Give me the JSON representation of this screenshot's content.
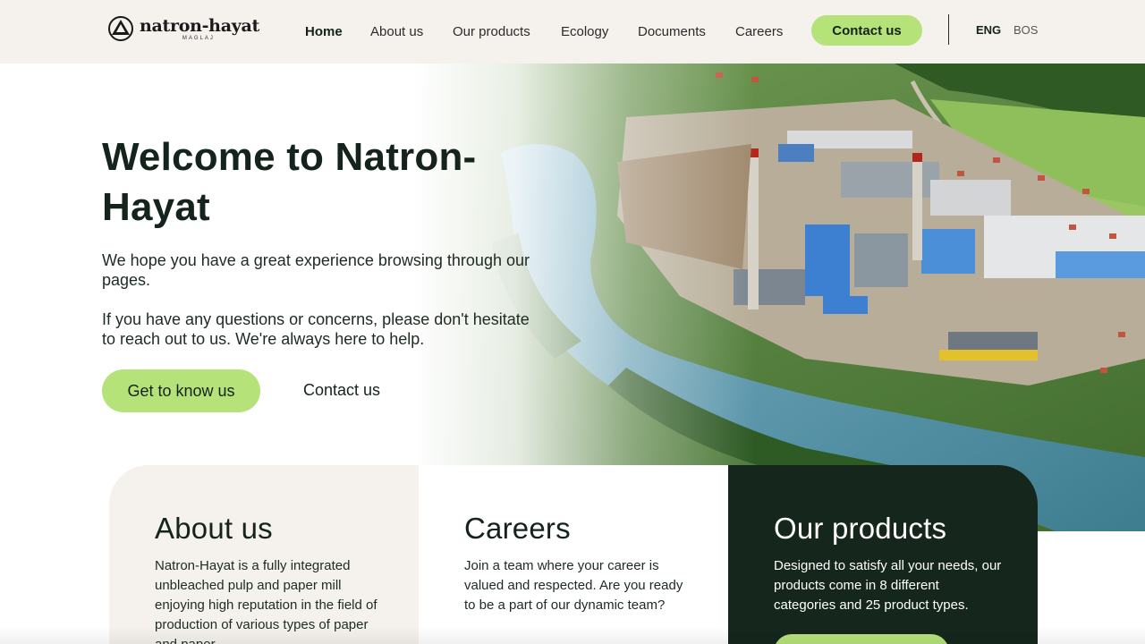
{
  "header": {
    "logo": {
      "name": "natron-hayat",
      "sub": "MAGLAJ"
    },
    "nav": [
      {
        "label": "Home",
        "active": true
      },
      {
        "label": "About us"
      },
      {
        "label": "Our products"
      },
      {
        "label": "Ecology"
      },
      {
        "label": "Documents"
      },
      {
        "label": "Careers"
      }
    ],
    "contact_button": "Contact us",
    "languages": [
      "ENG",
      "BOS"
    ],
    "active_language": "ENG"
  },
  "hero": {
    "title": "Welcome to Natron-Hayat",
    "paragraph1": "We hope you have a great experience browsing through our pages.",
    "paragraph2": "If you have any questions or concerns, please don't hesitate to reach out to us. We're always here to help.",
    "primary_button": "Get to know us",
    "secondary_link": "Contact us"
  },
  "cards": [
    {
      "title": "About us",
      "text": "Natron-Hayat is a fully integrated unbleached pulp and paper mill enjoying high reputation in the field of production of various types of paper and paper"
    },
    {
      "title": "Careers",
      "text": "Join a team where your career is valued and respected. Are you ready to be a part of our dynamic team?"
    },
    {
      "title": "Our products",
      "text": "Designed to satisfy all your needs, our products come in 8 different categories and 25 product types."
    }
  ],
  "colors": {
    "accent": "#b6e27a",
    "dark": "#15271d",
    "header_bg": "#f5f1ec"
  }
}
